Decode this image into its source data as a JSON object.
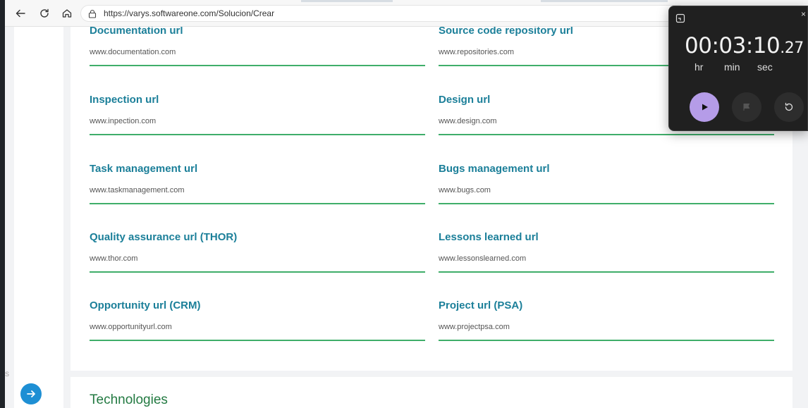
{
  "browser": {
    "url": "https://varys.softwareone.com/Solucion/Crear"
  },
  "form": {
    "fields": [
      {
        "label": "Documentation url",
        "value": "www.documentation.com"
      },
      {
        "label": "Source code repository url",
        "value": "www.repositories.com"
      },
      {
        "label": "Inspection url",
        "value": "www.inpection.com"
      },
      {
        "label": "Design url",
        "value": "www.design.com"
      },
      {
        "label": "Task management url",
        "value": "www.taskmanagement.com"
      },
      {
        "label": "Bugs management url",
        "value": "www.bugs.com"
      },
      {
        "label": "Quality assurance url (THOR)",
        "value": "www.thor.com"
      },
      {
        "label": "Lessons learned url",
        "value": "www.lessonslearned.com"
      },
      {
        "label": "Opportunity url (CRM)",
        "value": "www.opportunityurl.com"
      },
      {
        "label": "Project url (PSA)",
        "value": "www.projectpsa.com"
      }
    ]
  },
  "technologies": {
    "title": "Technologies"
  },
  "sidebar": {
    "edge_letter": "S"
  },
  "stopwatch": {
    "time_main": "00:03:10",
    "time_fraction": ".27",
    "unit_hr": "hr",
    "unit_min": "min",
    "unit_sec": "sec",
    "close_glyph": "×"
  },
  "colors": {
    "label": "#1b7f99",
    "underline": "#3fae6a",
    "section_title": "#237a42",
    "expand_button": "#1e8fd4",
    "play_button": "#b59ce8"
  }
}
